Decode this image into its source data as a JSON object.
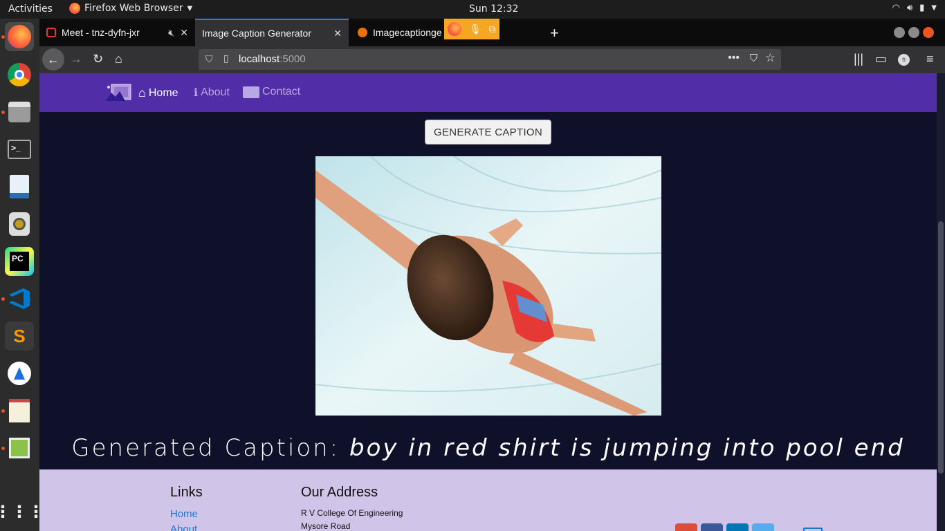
{
  "topbar": {
    "activities": "Activities",
    "app_name": "Firefox Web Browser",
    "clock": "Sun 12:32"
  },
  "tabs": [
    {
      "title": "Meet - tnz-dyfn-jxr"
    },
    {
      "title": "Image Caption Generator"
    },
    {
      "title": "Imagecaptionge"
    }
  ],
  "urlbar": {
    "host": "localhost",
    "port": ":5000"
  },
  "site": {
    "nav": [
      {
        "label": "Home"
      },
      {
        "label": "About"
      },
      {
        "label": "Contact"
      }
    ],
    "generate_button": "GENERATE CAPTION",
    "caption_label": "Generated Caption:",
    "caption_text": "boy in red shirt is jumping into pool end"
  },
  "footer": {
    "links_heading": "Links",
    "links": [
      "Home",
      "About"
    ],
    "address_heading": "Our Address",
    "address_lines": [
      "R V College Of Engineering",
      "Mysore Road"
    ]
  },
  "colors": {
    "nav_bg": "#512da8",
    "page_bg": "#0f1029",
    "footer_bg": "#d1c4e9",
    "active_tab_accent": "#0a84ff"
  }
}
